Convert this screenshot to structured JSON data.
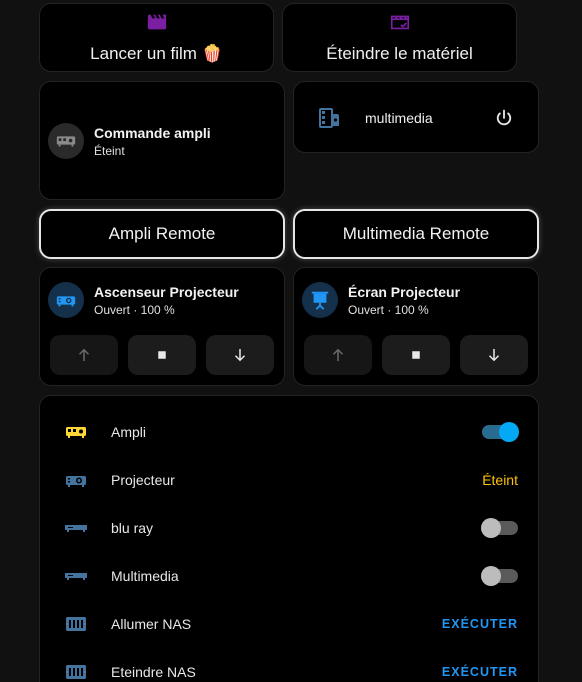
{
  "colors": {
    "accent": "#03a9f4",
    "scene_icon": "#7b1fa2",
    "ampli_on": "#fdd835",
    "entity_icon": "#44739e",
    "state_off": "#ffc107",
    "execute": "#2196f3"
  },
  "scenes": {
    "film": {
      "label": "Lancer un film 🍿",
      "icon": "movie-clapper-icon"
    },
    "off": {
      "label": "Éteindre le matériel",
      "icon": "movie-off-check-icon"
    }
  },
  "ampli_tile": {
    "title": "Commande ampli",
    "state": "Éteint",
    "icon": "amplifier-icon"
  },
  "multimedia_tile": {
    "title": "multimedia",
    "icon": "media-remote-icon",
    "power_icon": "power-icon"
  },
  "remotes": {
    "ampli": "Ampli Remote",
    "multimedia": "Multimedia Remote"
  },
  "covers": [
    {
      "title": "Ascenseur Projecteur",
      "state": "Ouvert · 100 %",
      "icon": "projector-icon"
    },
    {
      "title": "Écran Projecteur",
      "state": "Ouvert · 100 %",
      "icon": "projector-screen-icon"
    }
  ],
  "entities": [
    {
      "label": "Ampli",
      "icon": "amplifier-icon",
      "control": "toggle",
      "value": "on"
    },
    {
      "label": "Projecteur",
      "icon": "projector-icon",
      "control": "state",
      "value": "Éteint"
    },
    {
      "label": "blu ray",
      "icon": "set-top-box-icon",
      "control": "toggle",
      "value": "off"
    },
    {
      "label": "Multimedia",
      "icon": "set-top-box-icon",
      "control": "toggle",
      "value": "off"
    },
    {
      "label": "Allumer NAS",
      "icon": "nas-icon",
      "control": "button",
      "value": "EXÉCUTER"
    },
    {
      "label": "Eteindre NAS",
      "icon": "nas-icon",
      "control": "button",
      "value": "EXÉCUTER"
    }
  ]
}
